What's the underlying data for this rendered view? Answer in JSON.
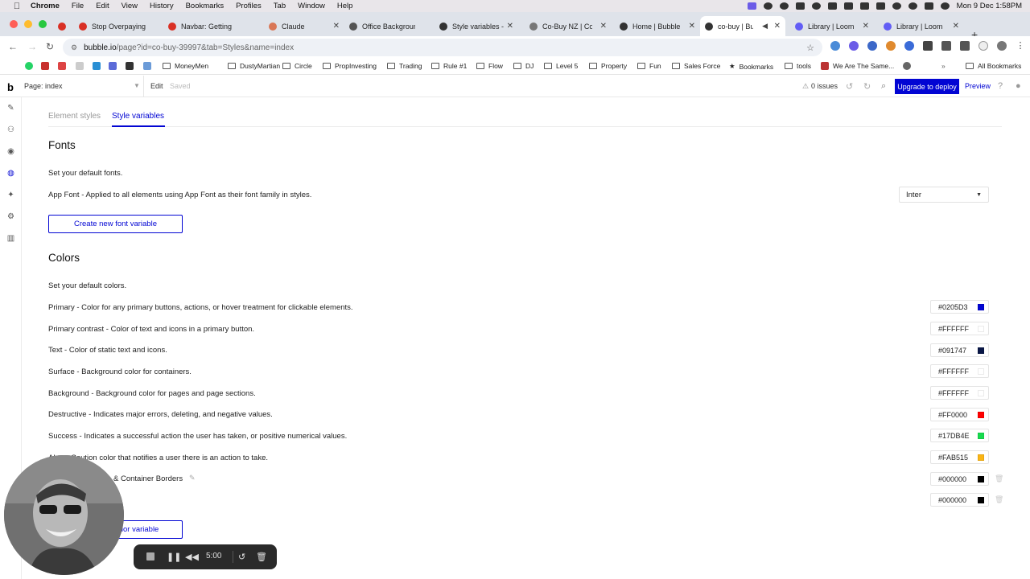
{
  "menubar": {
    "app": "Chrome",
    "items": [
      "File",
      "Edit",
      "View",
      "History",
      "Bookmarks",
      "Profiles",
      "Tab",
      "Window",
      "Help"
    ],
    "clock": "Mon 9 Dec  1:58PM"
  },
  "tabs": [
    {
      "label": "Stop Overpaying",
      "color": "#d93025"
    },
    {
      "label": "Navbar: Getting",
      "color": "#d93025"
    },
    {
      "label": "Claude",
      "color": "#d97757"
    },
    {
      "label": "Office Backgroun",
      "color": "#555555"
    },
    {
      "label": "Style variables -",
      "color": "#333333"
    },
    {
      "label": "Co-Buy NZ | Coll",
      "color": "#777777"
    },
    {
      "label": "Home | Bubble",
      "color": "#333333"
    },
    {
      "label": "co-buy | Bubb",
      "color": "#333333",
      "active": true
    },
    {
      "label": "Library | Loom",
      "color": "#625df5"
    },
    {
      "label": "Library | Loom",
      "color": "#625df5"
    }
  ],
  "browser": {
    "url_host": "bubble.io",
    "url_path": "/page?id=co-buy-39997&tab=Styles&name=index"
  },
  "bookmarks": [
    "MoneyMen",
    "DustyMartian",
    "Circle",
    "PropInvesting",
    "Trading",
    "Rule #1",
    "Flow",
    "DJ",
    "Level 5",
    "Property",
    "Fun",
    "Sales Force",
    "Bookmarks",
    "tools",
    "We Are The Same..."
  ],
  "all_bookmarks": "All Bookmarks",
  "editor": {
    "logo": "b",
    "page_selector": "Page: index",
    "edit": "Edit",
    "saved": "Saved",
    "issues": "0 issues",
    "deploy": "Upgrade to deploy",
    "preview": "Preview"
  },
  "subtabs": {
    "element_styles": "Element styles",
    "style_variables": "Style variables"
  },
  "fonts": {
    "heading": "Fonts",
    "intro": "Set your default fonts.",
    "app_font_desc": "App Font - Applied to all elements using App Font as their font family in styles.",
    "app_font_value": "Inter",
    "create_button": "Create new font variable"
  },
  "colors": {
    "heading": "Colors",
    "intro": "Set your default colors.",
    "rows": [
      {
        "desc": "Primary - Color for any primary buttons, actions, or hover treatment for clickable elements.",
        "hex": "#0205D3",
        "swatch": "#0205D3"
      },
      {
        "desc": "Primary contrast - Color of text and icons in a primary button.",
        "hex": "#FFFFFF",
        "swatch": "#FFFFFF"
      },
      {
        "desc": "Text - Color of static text and icons.",
        "hex": "#091747",
        "swatch": "#091747"
      },
      {
        "desc": "Surface - Background color for containers.",
        "hex": "#FFFFFF",
        "swatch": "#FFFFFF"
      },
      {
        "desc": "Background - Background color for pages and page sections.",
        "hex": "#FFFFFF",
        "swatch": "#FFFFFF"
      },
      {
        "desc": "Destructive - Indicates major errors, deleting, and negative values.",
        "hex": "#FF0000",
        "swatch": "#FF0000"
      },
      {
        "desc": "Success - Indicates a successful action the user has taken, or positive numerical values.",
        "hex": "#17DB4E",
        "swatch": "#17DB4E"
      },
      {
        "desc": "Alert - Caution color that notifies a user there is an action to take.",
        "hex": "#FAB515",
        "swatch": "#FAB515"
      }
    ],
    "custom_rows": [
      {
        "desc": "& Container Borders",
        "hex": "#000000",
        "swatch": "#000000"
      },
      {
        "desc": "",
        "hex": "#000000",
        "swatch": "#000000"
      }
    ],
    "create_button": "Create new color variable"
  },
  "recorder": {
    "timer": "5:00"
  }
}
